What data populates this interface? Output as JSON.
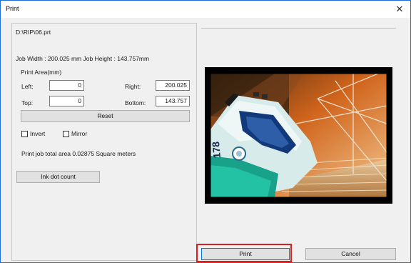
{
  "window": {
    "title": "Print",
    "close_glyph": "✕"
  },
  "file_path": "D:\\RIP\\06.prt",
  "job_size": "Job Width : 200.025 mm Job Height : 143.757mm",
  "print_area": {
    "label": "Print Area(mm)",
    "left_label": "Left:",
    "left_value": "0",
    "right_label": "Right:",
    "right_value": "200.025",
    "top_label": "Top:",
    "top_value": "0",
    "bottom_label": "Bottom:",
    "bottom_value": "143.757"
  },
  "buttons": {
    "reset": "Reset",
    "ink_dot_count": "Ink dot count",
    "print": "Print",
    "cancel": "Cancel"
  },
  "options": {
    "invert_label": "Invert",
    "invert_checked": false,
    "mirror_label": "Mirror",
    "mirror_checked": false
  },
  "total_area": "Print job total area 0.02875 Square meters",
  "preview_number": "178",
  "colors": {
    "highlight": "#d42020",
    "title_border": "#1e6fd4",
    "focus_border": "#0078d7"
  }
}
